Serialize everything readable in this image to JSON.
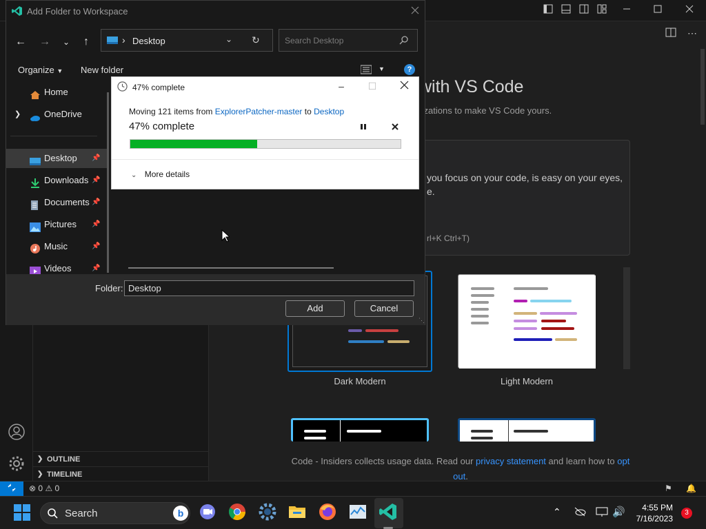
{
  "colors": {
    "accent": "#0078d4",
    "progress": "#06b025",
    "link": "#3794ff",
    "notification_badge": "#e81123"
  },
  "vscode": {
    "welcome": {
      "title": "with VS Code",
      "subtitle": "fizations to make VS Code yours.",
      "card_line1": "you focus on your code, is easy on your eyes,",
      "card_line2": "e.",
      "card_shortcut": "rl+K Ctrl+T)"
    },
    "themes": [
      {
        "label": "Dark Modern",
        "selected": true
      },
      {
        "label": "Light Modern",
        "selected": false
      }
    ],
    "privacy": {
      "text1": "Code - Insiders collects usage data. Read our ",
      "link1": "privacy statement",
      "text2": " and learn how to ",
      "link2": "opt out",
      "text3": "."
    },
    "sidebar_sections": {
      "outline": "OUTLINE",
      "timeline": "TIMELINE"
    },
    "status": {
      "errors": "0",
      "warnings": "0"
    }
  },
  "file_dialog": {
    "title": "Add Folder to Workspace",
    "address": "Desktop",
    "search_placeholder": "Search Desktop",
    "organize_label": "Organize",
    "new_folder_label": "New folder",
    "nav_items": [
      {
        "label": "Home",
        "icon": "home-icon"
      },
      {
        "label": "OneDrive",
        "icon": "cloud-icon"
      },
      {
        "label": "Desktop",
        "icon": "desktop-icon",
        "pinned": true,
        "selected": true
      },
      {
        "label": "Downloads",
        "icon": "download-icon",
        "pinned": true
      },
      {
        "label": "Documents",
        "icon": "document-icon",
        "pinned": true
      },
      {
        "label": "Pictures",
        "icon": "picture-icon",
        "pinned": true
      },
      {
        "label": "Music",
        "icon": "music-icon",
        "pinned": true
      },
      {
        "label": "Videos",
        "icon": "video-icon",
        "pinned": true
      }
    ],
    "folder_label": "Folder:",
    "folder_value": "Desktop",
    "add_label": "Add",
    "cancel_label": "Cancel"
  },
  "progress_dialog": {
    "title": "47% complete",
    "moving_prefix": "Moving 121 items from ",
    "source": "ExplorerPatcher-master",
    "to_word": " to ",
    "destination": "Desktop",
    "status": "47% complete",
    "percent": 47,
    "more_details": "More details"
  },
  "taskbar": {
    "search_label": "Search",
    "time": "4:55 PM",
    "date": "7/16/2023",
    "notification_count": "3"
  }
}
